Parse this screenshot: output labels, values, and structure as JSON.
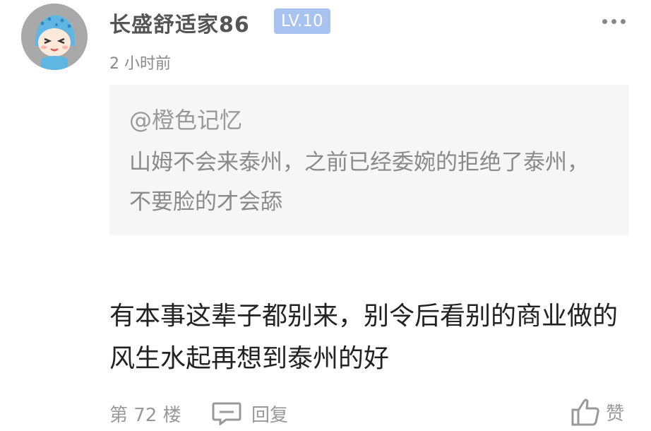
{
  "post": {
    "author": "长盛舒适家86",
    "level": "LV.10",
    "time": "2 小时前",
    "quote": {
      "author": "@橙色记忆",
      "text": "山姆不会来泰州，之前已经委婉的拒绝了泰州，不要脸的才会舔"
    },
    "body": "有本事这辈子都别来，别令后看别的商业做的风生水起再想到泰州的好",
    "floor": "第 72 楼",
    "reply_label": "回复",
    "like_label": "赞"
  },
  "icons": {
    "avatar": "cartoon-avatar-icon",
    "more": "more-dots-icon",
    "reply": "comment-icon",
    "like": "thumbs-up-icon"
  },
  "colors": {
    "level_badge": "#a8c3ef",
    "quote_bg": "#f6f6f6",
    "meta_text": "#999999",
    "body_text": "#222222"
  }
}
